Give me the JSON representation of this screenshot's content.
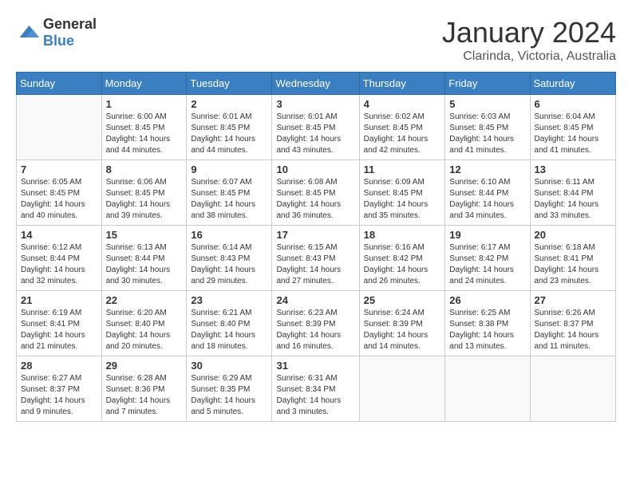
{
  "header": {
    "logo_general": "General",
    "logo_blue": "Blue",
    "month": "January 2024",
    "location": "Clarinda, Victoria, Australia"
  },
  "weekdays": [
    "Sunday",
    "Monday",
    "Tuesday",
    "Wednesday",
    "Thursday",
    "Friday",
    "Saturday"
  ],
  "weeks": [
    [
      {
        "day": "",
        "info": ""
      },
      {
        "day": "1",
        "info": "Sunrise: 6:00 AM\nSunset: 8:45 PM\nDaylight: 14 hours and 44 minutes."
      },
      {
        "day": "2",
        "info": "Sunrise: 6:01 AM\nSunset: 8:45 PM\nDaylight: 14 hours and 44 minutes."
      },
      {
        "day": "3",
        "info": "Sunrise: 6:01 AM\nSunset: 8:45 PM\nDaylight: 14 hours and 43 minutes."
      },
      {
        "day": "4",
        "info": "Sunrise: 6:02 AM\nSunset: 8:45 PM\nDaylight: 14 hours and 42 minutes."
      },
      {
        "day": "5",
        "info": "Sunrise: 6:03 AM\nSunset: 8:45 PM\nDaylight: 14 hours and 41 minutes."
      },
      {
        "day": "6",
        "info": "Sunrise: 6:04 AM\nSunset: 8:45 PM\nDaylight: 14 hours and 41 minutes."
      }
    ],
    [
      {
        "day": "7",
        "info": "Sunrise: 6:05 AM\nSunset: 8:45 PM\nDaylight: 14 hours and 40 minutes."
      },
      {
        "day": "8",
        "info": "Sunrise: 6:06 AM\nSunset: 8:45 PM\nDaylight: 14 hours and 39 minutes."
      },
      {
        "day": "9",
        "info": "Sunrise: 6:07 AM\nSunset: 8:45 PM\nDaylight: 14 hours and 38 minutes."
      },
      {
        "day": "10",
        "info": "Sunrise: 6:08 AM\nSunset: 8:45 PM\nDaylight: 14 hours and 36 minutes."
      },
      {
        "day": "11",
        "info": "Sunrise: 6:09 AM\nSunset: 8:45 PM\nDaylight: 14 hours and 35 minutes."
      },
      {
        "day": "12",
        "info": "Sunrise: 6:10 AM\nSunset: 8:44 PM\nDaylight: 14 hours and 34 minutes."
      },
      {
        "day": "13",
        "info": "Sunrise: 6:11 AM\nSunset: 8:44 PM\nDaylight: 14 hours and 33 minutes."
      }
    ],
    [
      {
        "day": "14",
        "info": "Sunrise: 6:12 AM\nSunset: 8:44 PM\nDaylight: 14 hours and 32 minutes."
      },
      {
        "day": "15",
        "info": "Sunrise: 6:13 AM\nSunset: 8:44 PM\nDaylight: 14 hours and 30 minutes."
      },
      {
        "day": "16",
        "info": "Sunrise: 6:14 AM\nSunset: 8:43 PM\nDaylight: 14 hours and 29 minutes."
      },
      {
        "day": "17",
        "info": "Sunrise: 6:15 AM\nSunset: 8:43 PM\nDaylight: 14 hours and 27 minutes."
      },
      {
        "day": "18",
        "info": "Sunrise: 6:16 AM\nSunset: 8:42 PM\nDaylight: 14 hours and 26 minutes."
      },
      {
        "day": "19",
        "info": "Sunrise: 6:17 AM\nSunset: 8:42 PM\nDaylight: 14 hours and 24 minutes."
      },
      {
        "day": "20",
        "info": "Sunrise: 6:18 AM\nSunset: 8:41 PM\nDaylight: 14 hours and 23 minutes."
      }
    ],
    [
      {
        "day": "21",
        "info": "Sunrise: 6:19 AM\nSunset: 8:41 PM\nDaylight: 14 hours and 21 minutes."
      },
      {
        "day": "22",
        "info": "Sunrise: 6:20 AM\nSunset: 8:40 PM\nDaylight: 14 hours and 20 minutes."
      },
      {
        "day": "23",
        "info": "Sunrise: 6:21 AM\nSunset: 8:40 PM\nDaylight: 14 hours and 18 minutes."
      },
      {
        "day": "24",
        "info": "Sunrise: 6:23 AM\nSunset: 8:39 PM\nDaylight: 14 hours and 16 minutes."
      },
      {
        "day": "25",
        "info": "Sunrise: 6:24 AM\nSunset: 8:39 PM\nDaylight: 14 hours and 14 minutes."
      },
      {
        "day": "26",
        "info": "Sunrise: 6:25 AM\nSunset: 8:38 PM\nDaylight: 14 hours and 13 minutes."
      },
      {
        "day": "27",
        "info": "Sunrise: 6:26 AM\nSunset: 8:37 PM\nDaylight: 14 hours and 11 minutes."
      }
    ],
    [
      {
        "day": "28",
        "info": "Sunrise: 6:27 AM\nSunset: 8:37 PM\nDaylight: 14 hours and 9 minutes."
      },
      {
        "day": "29",
        "info": "Sunrise: 6:28 AM\nSunset: 8:36 PM\nDaylight: 14 hours and 7 minutes."
      },
      {
        "day": "30",
        "info": "Sunrise: 6:29 AM\nSunset: 8:35 PM\nDaylight: 14 hours and 5 minutes."
      },
      {
        "day": "31",
        "info": "Sunrise: 6:31 AM\nSunset: 8:34 PM\nDaylight: 14 hours and 3 minutes."
      },
      {
        "day": "",
        "info": ""
      },
      {
        "day": "",
        "info": ""
      },
      {
        "day": "",
        "info": ""
      }
    ]
  ]
}
